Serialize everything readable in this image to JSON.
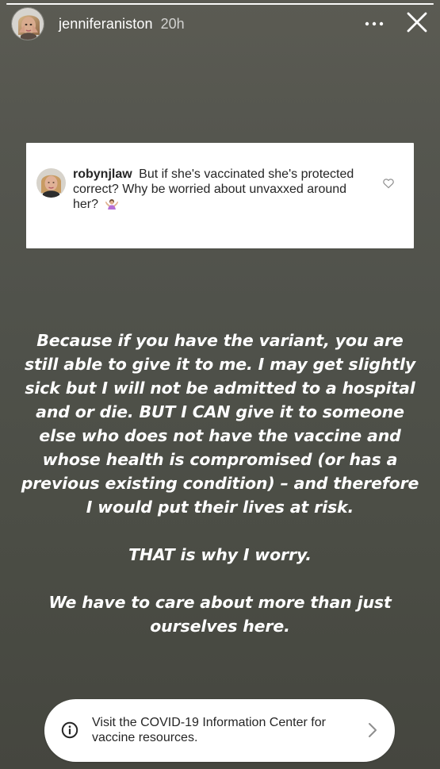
{
  "story": {
    "progress": 1,
    "header": {
      "username": "jenniferaniston",
      "time": "20h",
      "icons": {
        "avatar": "profile-avatar",
        "more": "more-icon",
        "close": "close-icon"
      }
    },
    "comment_card": {
      "username": "robynjlaw",
      "text": "But if she's vaccinated she's protected correct? Why be worried about unvaxxed around her?",
      "emoji": "person-shrugging",
      "icons": {
        "avatar": "commenter-avatar",
        "like": "heart-icon"
      }
    },
    "message": {
      "paragraph1": "Because if you have the variant, you are still able to give it to me. I may get slightly sick but I will not be admitted to a hospital and or die. BUT I CAN give it to someone else who does not have the vaccine and whose health is compromised (or has a previous existing condition) – and therefore I would put their lives at risk.",
      "paragraph2": "THAT is why I worry.",
      "paragraph3": "We have to care about more than just ourselves here."
    },
    "info_banner": {
      "text": "Visit the COVID-19 Information Center for vaccine resources.",
      "icons": {
        "info": "info-icon",
        "chevron": "chevron-right-icon"
      }
    },
    "colors": {
      "background": "#4f514a",
      "text_primary": "#ffffff",
      "card_text": "#262626",
      "card_background": "#ffffff"
    }
  }
}
